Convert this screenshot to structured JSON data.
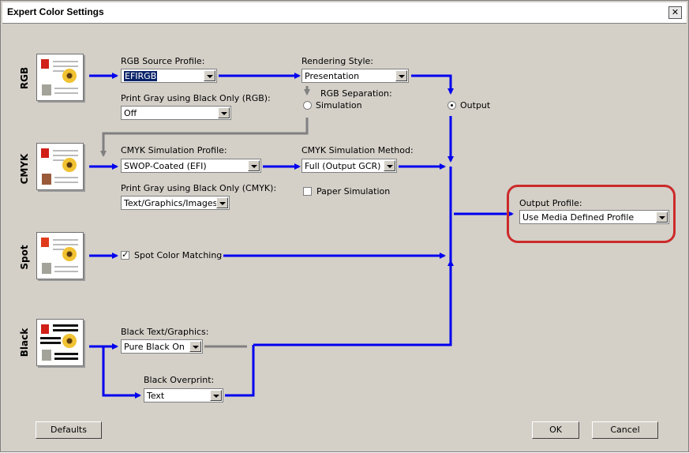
{
  "window": {
    "title": "Expert Color Settings",
    "close_glyph": "✕"
  },
  "rows": {
    "rgb": "RGB",
    "cmyk": "CMYK",
    "spot": "Spot",
    "black": "Black"
  },
  "rgb": {
    "source_profile_label": "RGB Source Profile:",
    "source_profile_value": "EFIRGB",
    "print_gray_label": "Print Gray using Black Only (RGB):",
    "print_gray_value": "Off",
    "rendering_style_label": "Rendering Style:",
    "rendering_style_value": "Presentation",
    "separation_label": "RGB Separation:",
    "simulation_option": "Simulation",
    "output_option": "Output",
    "selected_separation": "Output"
  },
  "cmyk": {
    "simulation_profile_label": "CMYK Simulation Profile:",
    "simulation_profile_value": "SWOP-Coated (EFI)",
    "print_gray_label": "Print Gray using Black Only (CMYK):",
    "print_gray_value": "Text/Graphics/Images",
    "simulation_method_label": "CMYK Simulation Method:",
    "simulation_method_value": "Full (Output GCR)",
    "paper_simulation_label": "Paper Simulation",
    "paper_simulation_checked": false
  },
  "spot": {
    "matching_label": "Spot Color Matching",
    "matching_checked": true
  },
  "black": {
    "text_graphics_label": "Black Text/Graphics:",
    "text_graphics_value": "Pure Black On",
    "overprint_label": "Black Overprint:",
    "overprint_value": "Text"
  },
  "output": {
    "profile_label": "Output Profile:",
    "profile_value": "Use Media Defined Profile"
  },
  "buttons": {
    "defaults": "Defaults",
    "ok": "OK",
    "cancel": "Cancel"
  },
  "colors": {
    "flow_blue": "#0000ee",
    "flow_gray": "#808080",
    "highlight_red": "#cc2a2a"
  },
  "icons": [
    "close-icon",
    "dropdown-arrow-icon",
    "flow-arrow-icon",
    "document-thumbnail-icon"
  ]
}
